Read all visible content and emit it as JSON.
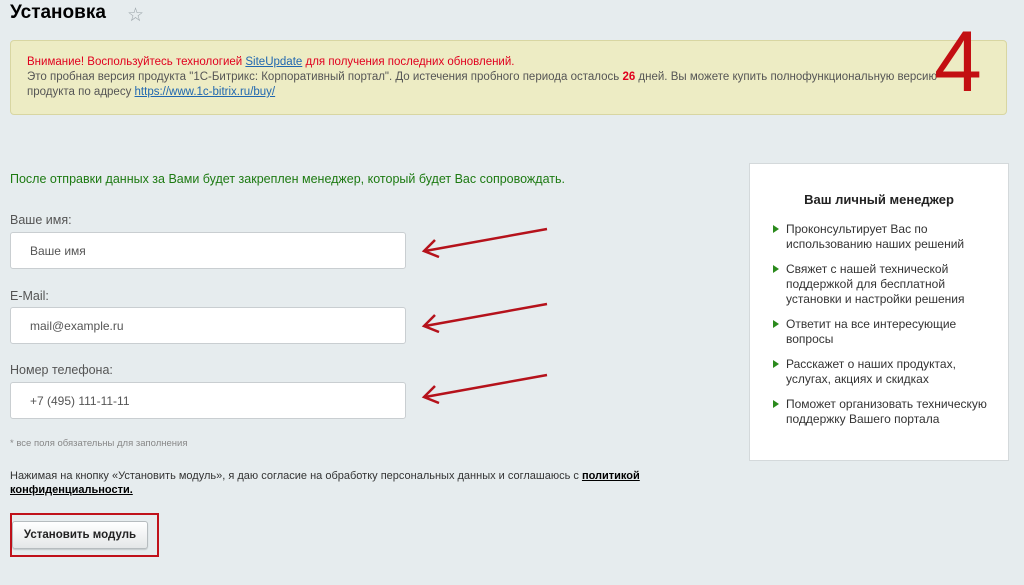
{
  "header": {
    "title": "Установка",
    "favorite_icon": "star-icon"
  },
  "notice": {
    "warn_prefix": "Внимание! Воспользуйтесь технологией ",
    "warn_link": "SiteUpdate",
    "warn_suffix": " для получения последних обновлений.",
    "info_text_1": "Это пробная версия продукта \"1С-Битрикс: Корпоративный портал\". До истечения пробного периода осталось ",
    "days_left": "26",
    "info_text_2": " дней. Вы можете купить полнофункциональную версию",
    "info_text_3": "продукта по адресу ",
    "buy_link": "https://www.1c-bitrix.ru/buy/"
  },
  "annotation": {
    "step_number": "4",
    "step_color": "#c30f12",
    "arrow_color": "#b5121b"
  },
  "form": {
    "intro": "После отправки данных за Вами будет закреплен менеджер, который будет Вас сопровождать.",
    "name_label": "Ваше имя:",
    "name_placeholder": "Ваше имя",
    "email_label": "E-Mail:",
    "email_placeholder": "mail@example.ru",
    "phone_label": "Номер телефона:",
    "phone_placeholder": "+7 (495) 111-11-11",
    "required_note": "* все поля обязательны для заполнения",
    "consent_text": "Нажимая на кнопку «Установить модуль», я даю согласие на обработку персональных данных и соглашаюсь с ",
    "consent_link": "политикой конфиденциальности.",
    "submit_label": "Установить модуль"
  },
  "manager": {
    "title": "Ваш личный менеджер",
    "items": [
      "Проконсультирует Вас по использованию наших решений",
      "Свяжет с нашей технической поддержкой для бесплатной установки и настройки решения",
      "Ответит на все интересующие вопросы",
      "Расскажет о наших продуктах, услугах, акциях и скидках",
      "Поможет организовать техническую поддержку Вашего портала"
    ]
  }
}
